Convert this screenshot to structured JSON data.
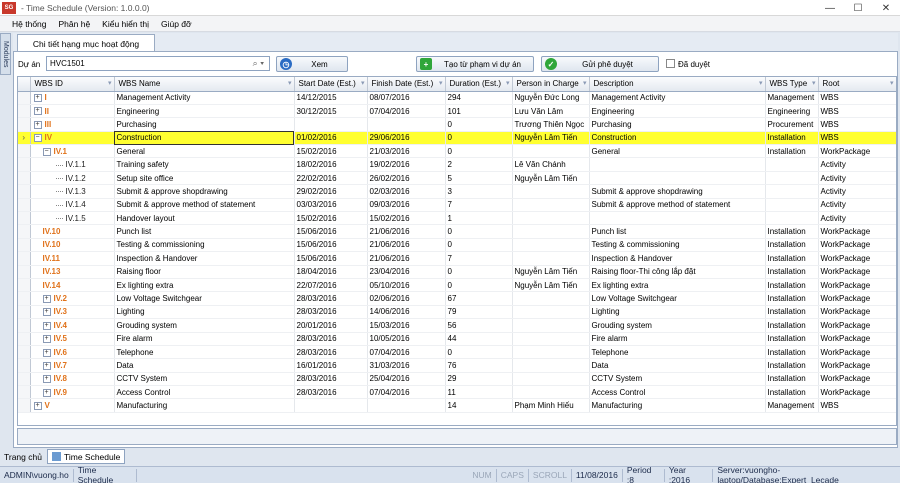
{
  "window": {
    "title": "- Time Schedule (Version: 1.0.0.0)",
    "icon_text": "SG",
    "min": "—",
    "max": "☐",
    "close": "✕"
  },
  "menu": [
    "Hệ thống",
    "Phân hệ",
    "Kiểu hiển thị",
    "Giúp đỡ"
  ],
  "sidebar_tab": "Modules",
  "doc_tab": "Chi tiết hạng mục hoạt động",
  "filter": {
    "project_label": "Dự án",
    "project_value": "HVC1501",
    "view_button": "Xem",
    "create_button": "Tạo từ phạm vi dự án",
    "submit_button": "Gửi phê duyệt",
    "approved_label": "Đã duyệt"
  },
  "columns": [
    "WBS ID",
    "WBS Name",
    "Start Date (Est.)",
    "Finish Date (Est.)",
    "Duration (Est.)",
    "Person in Charge",
    "Description",
    "WBS Type",
    "Root"
  ],
  "rows": [
    {
      "indicator": "",
      "toggle": "+",
      "level": 1,
      "id": "I",
      "orange": true,
      "name": "Management Activity",
      "start": "14/12/2015",
      "finish": "08/07/2016",
      "dur": "294",
      "person": "Nguyễn Đức Long",
      "desc": "Management Activity",
      "type": "Management",
      "root": "WBS"
    },
    {
      "indicator": "",
      "toggle": "+",
      "level": 1,
      "id": "II",
      "orange": true,
      "name": "Engineering",
      "start": "30/12/2015",
      "finish": "07/04/2016",
      "dur": "101",
      "person": "Lưu Văn Lâm",
      "desc": "Engineering",
      "type": "Engineering",
      "root": "WBS"
    },
    {
      "indicator": "",
      "toggle": "+",
      "level": 1,
      "id": "III",
      "orange": true,
      "name": "Purchasing",
      "start": "",
      "finish": "",
      "dur": "0",
      "person": "Trương Thiên Ngọc",
      "desc": "Purchasing",
      "type": "Procurement",
      "root": "WBS"
    },
    {
      "indicator": "›",
      "toggle": "−",
      "level": 1,
      "id": "IV",
      "orange": true,
      "selected": true,
      "name": "Construction",
      "start": "01/02/2016",
      "finish": "29/06/2016",
      "dur": "0",
      "person": "Nguyễn Lâm Tiến",
      "desc": "Construction",
      "type": "Installation",
      "root": "WBS"
    },
    {
      "indicator": "",
      "toggle": "−",
      "level": 2,
      "id": "IV.1",
      "orange": true,
      "name": "General",
      "start": "15/02/2016",
      "finish": "21/03/2016",
      "dur": "0",
      "person": "",
      "desc": "General",
      "type": "Installation",
      "root": "WorkPackage"
    },
    {
      "indicator": "",
      "toggle": "",
      "level": 3,
      "id": "IV.1.1",
      "orange": false,
      "name": "Training safety",
      "start": "18/02/2016",
      "finish": "19/02/2016",
      "dur": "2",
      "person": "Lê Văn Chánh",
      "desc": "",
      "type": "",
      "root": "Activity"
    },
    {
      "indicator": "",
      "toggle": "",
      "level": 3,
      "id": "IV.1.2",
      "orange": false,
      "name": "Setup site office",
      "start": "22/02/2016",
      "finish": "26/02/2016",
      "dur": "5",
      "person": "Nguyễn Lâm Tiến",
      "desc": "",
      "type": "",
      "root": "Activity"
    },
    {
      "indicator": "",
      "toggle": "",
      "level": 3,
      "id": "IV.1.3",
      "orange": false,
      "name": "Submit & approve shopdrawing",
      "start": "29/02/2016",
      "finish": "02/03/2016",
      "dur": "3",
      "person": "",
      "desc": "Submit & approve shopdrawing",
      "type": "",
      "root": "Activity"
    },
    {
      "indicator": "",
      "toggle": "",
      "level": 3,
      "id": "IV.1.4",
      "orange": false,
      "name": "Submit & approve method of statement",
      "start": "03/03/2016",
      "finish": "09/03/2016",
      "dur": "7",
      "person": "",
      "desc": "Submit & approve method of statement",
      "type": "",
      "root": "Activity"
    },
    {
      "indicator": "",
      "toggle": "",
      "level": 3,
      "id": "IV.1.5",
      "orange": false,
      "name": "Handover layout",
      "start": "15/02/2016",
      "finish": "15/02/2016",
      "dur": "1",
      "person": "",
      "desc": "",
      "type": "",
      "root": "Activity"
    },
    {
      "indicator": "",
      "toggle": "",
      "level": 2,
      "id": "IV.10",
      "orange": true,
      "name": "Punch list",
      "start": "15/06/2016",
      "finish": "21/06/2016",
      "dur": "0",
      "person": "",
      "desc": "Punch list",
      "type": "Installation",
      "root": "WorkPackage"
    },
    {
      "indicator": "",
      "toggle": "",
      "level": 2,
      "id": "IV.10",
      "orange": true,
      "name": "Testing & commissioning",
      "start": "15/06/2016",
      "finish": "21/06/2016",
      "dur": "0",
      "person": "",
      "desc": "Testing & commissioning",
      "type": "Installation",
      "root": "WorkPackage"
    },
    {
      "indicator": "",
      "toggle": "",
      "level": 2,
      "id": "IV.11",
      "orange": true,
      "name": "Inspection & Handover",
      "start": "15/06/2016",
      "finish": "21/06/2016",
      "dur": "7",
      "person": "",
      "desc": "Inspection & Handover",
      "type": "Installation",
      "root": "WorkPackage"
    },
    {
      "indicator": "",
      "toggle": "",
      "level": 2,
      "id": "IV.13",
      "orange": true,
      "name": "Raising floor",
      "start": "18/04/2016",
      "finish": "23/04/2016",
      "dur": "0",
      "person": "Nguyễn Lâm Tiến",
      "desc": "Raising floor-Thi công lắp đặt",
      "type": "Installation",
      "root": "WorkPackage"
    },
    {
      "indicator": "",
      "toggle": "",
      "level": 2,
      "id": "IV.14",
      "orange": true,
      "name": "Ex lighting extra",
      "start": "22/07/2016",
      "finish": "05/10/2016",
      "dur": "0",
      "person": "Nguyễn Lâm Tiến",
      "desc": "Ex lighting extra",
      "type": "Installation",
      "root": "WorkPackage"
    },
    {
      "indicator": "",
      "toggle": "+",
      "level": 2,
      "id": "IV.2",
      "orange": true,
      "name": "Low Voltage Switchgear",
      "start": "28/03/2016",
      "finish": "02/06/2016",
      "dur": "67",
      "person": "",
      "desc": "Low Voltage Switchgear",
      "type": "Installation",
      "root": "WorkPackage"
    },
    {
      "indicator": "",
      "toggle": "+",
      "level": 2,
      "id": "IV.3",
      "orange": true,
      "name": "Lighting",
      "start": "28/03/2016",
      "finish": "14/06/2016",
      "dur": "79",
      "person": "",
      "desc": "Lighting",
      "type": "Installation",
      "root": "WorkPackage"
    },
    {
      "indicator": "",
      "toggle": "+",
      "level": 2,
      "id": "IV.4",
      "orange": true,
      "name": "Grouding system",
      "start": "20/01/2016",
      "finish": "15/03/2016",
      "dur": "56",
      "person": "",
      "desc": "Grouding system",
      "type": "Installation",
      "root": "WorkPackage"
    },
    {
      "indicator": "",
      "toggle": "+",
      "level": 2,
      "id": "IV.5",
      "orange": true,
      "name": "Fire alarm",
      "start": "28/03/2016",
      "finish": "10/05/2016",
      "dur": "44",
      "person": "",
      "desc": "Fire alarm",
      "type": "Installation",
      "root": "WorkPackage"
    },
    {
      "indicator": "",
      "toggle": "+",
      "level": 2,
      "id": "IV.6",
      "orange": true,
      "name": "Telephone",
      "start": "28/03/2016",
      "finish": "07/04/2016",
      "dur": "0",
      "person": "",
      "desc": "Telephone",
      "type": "Installation",
      "root": "WorkPackage"
    },
    {
      "indicator": "",
      "toggle": "+",
      "level": 2,
      "id": "IV.7",
      "orange": true,
      "name": "Data",
      "start": "16/01/2016",
      "finish": "31/03/2016",
      "dur": "76",
      "person": "",
      "desc": "Data",
      "type": "Installation",
      "root": "WorkPackage"
    },
    {
      "indicator": "",
      "toggle": "+",
      "level": 2,
      "id": "IV.8",
      "orange": true,
      "name": "CCTV System",
      "start": "28/03/2016",
      "finish": "25/04/2016",
      "dur": "29",
      "person": "",
      "desc": "CCTV System",
      "type": "Installation",
      "root": "WorkPackage"
    },
    {
      "indicator": "",
      "toggle": "+",
      "level": 2,
      "id": "IV.9",
      "orange": true,
      "name": "Access Control",
      "start": "28/03/2016",
      "finish": "07/04/2016",
      "dur": "11",
      "person": "",
      "desc": "Access Control",
      "type": "Installation",
      "root": "WorkPackage"
    },
    {
      "indicator": "",
      "toggle": "+",
      "level": 1,
      "id": "V",
      "orange": true,
      "name": "Manufacturing",
      "start": "",
      "finish": "",
      "dur": "14",
      "person": "Phạm Minh Hiếu",
      "desc": "Manufacturing",
      "type": "Management",
      "root": "WBS"
    }
  ],
  "bottom": {
    "home": "Trang chủ",
    "tab": "Time Schedule"
  },
  "status": {
    "user": "ADMIN\\vuong.ho",
    "module": "Time Schedule",
    "num": "NUM",
    "caps": "CAPS",
    "scroll": "SCROLL",
    "date": "11/08/2016",
    "period": "Period :8",
    "year": "Year :2016",
    "server": "Server:vuongho-laptop/Database:Expert_Lecade"
  },
  "colors": {
    "orange": "#e0721a",
    "selected": "#ffff30",
    "accent": "#2b6cc4"
  }
}
